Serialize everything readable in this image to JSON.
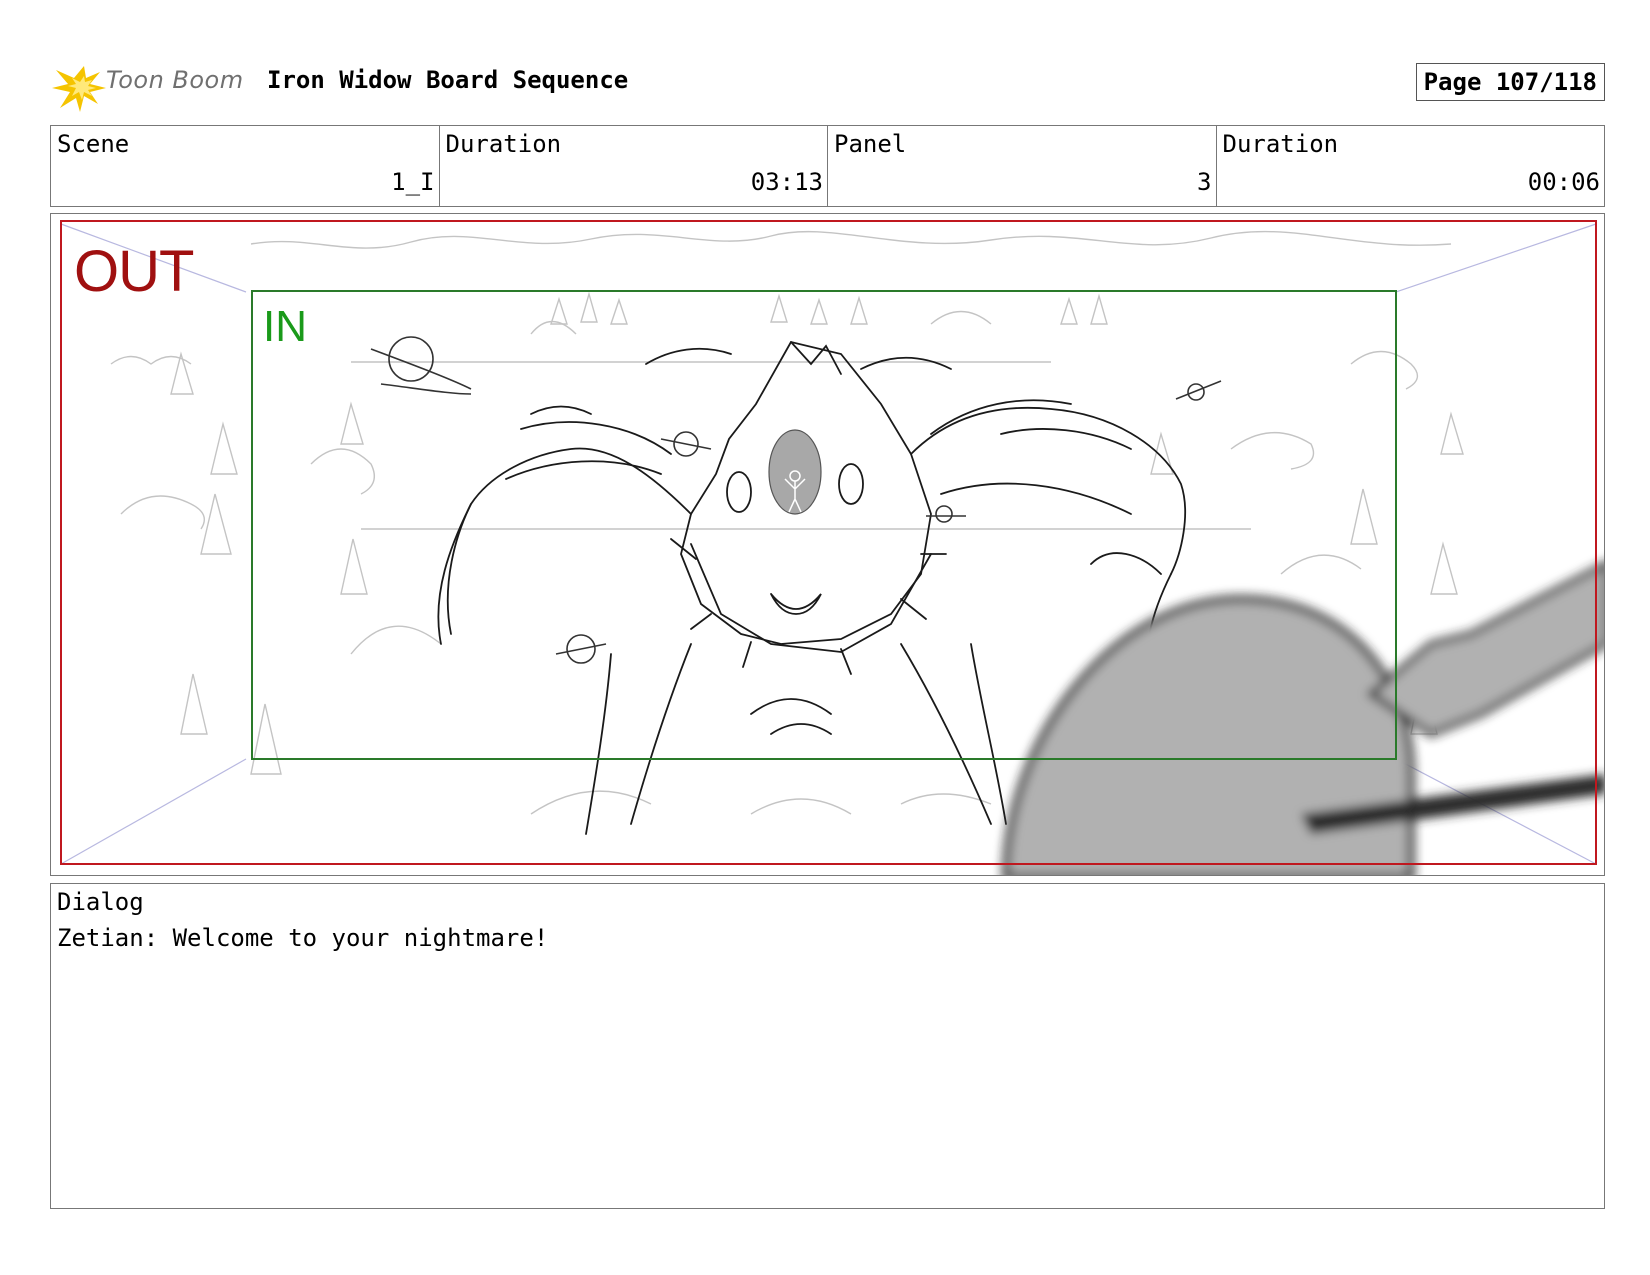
{
  "header": {
    "logo_text": "Toon Boom",
    "title": "Iron Widow Board Sequence",
    "page": "Page 107/118"
  },
  "info": [
    {
      "label": "Scene",
      "value": "1_I"
    },
    {
      "label": "Duration",
      "value": "03:13"
    },
    {
      "label": "Panel",
      "value": "3"
    },
    {
      "label": "Duration",
      "value": "00:06"
    }
  ],
  "panel": {
    "out_label": "OUT",
    "in_label": "IN"
  },
  "dialog": {
    "label": "Dialog",
    "text": "Zetian: Welcome to your nightmare!"
  },
  "colors": {
    "out_frame": "#c0181f",
    "in_frame": "#2a7a2a",
    "logo_star": "#f5c400"
  }
}
